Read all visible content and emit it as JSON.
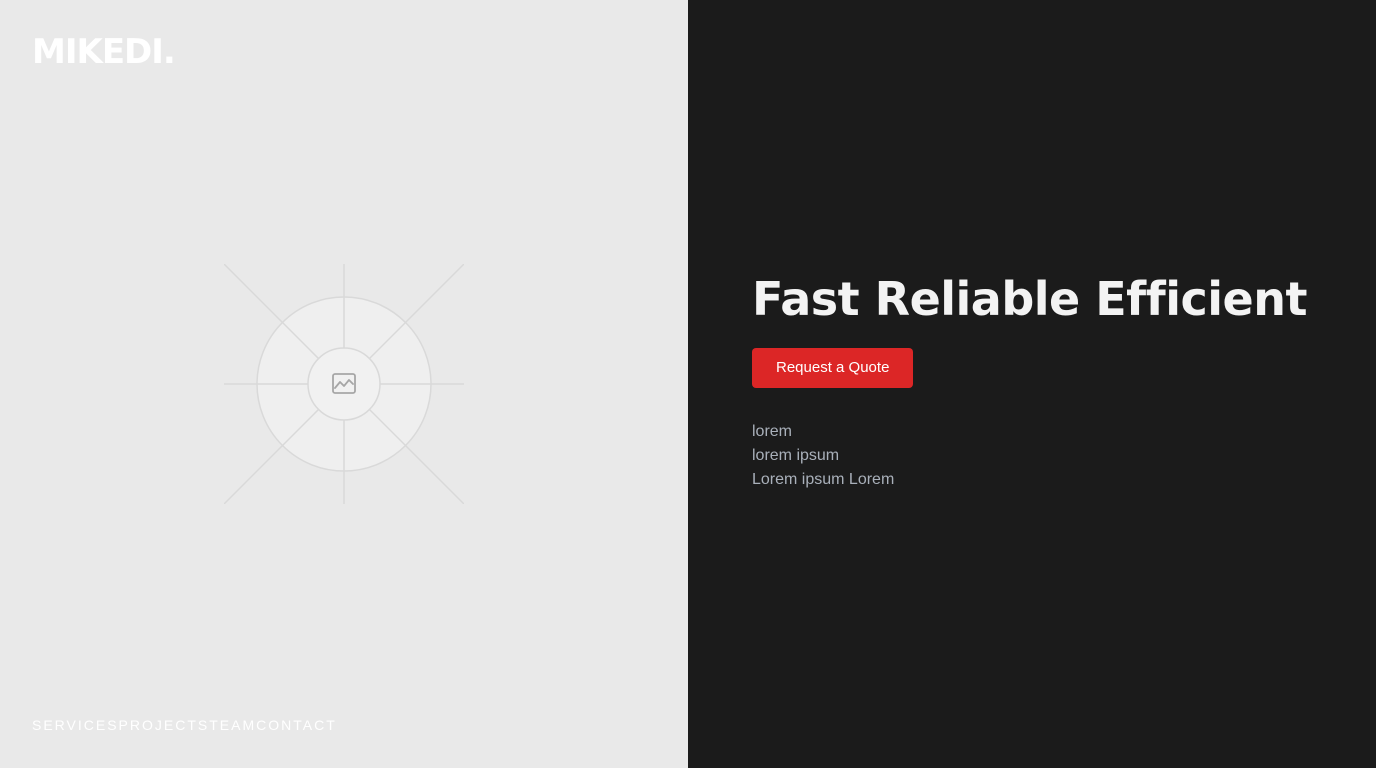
{
  "brand": {
    "logo_text": "MIKEDI."
  },
  "hero": {
    "image_placeholder_icon": "image-icon",
    "headline": "Fast Reliable Efficient",
    "cta_label": "Request a Quote",
    "features": [
      "lorem",
      "lorem ipsum",
      "Lorem ipsum Lorem"
    ]
  },
  "nav": {
    "items": [
      {
        "label": "SERVICES"
      },
      {
        "label": "PROJECTS"
      },
      {
        "label": "TEAM"
      },
      {
        "label": "CONTACT"
      }
    ]
  },
  "colors": {
    "left_panel_bg": "#e9e9e9",
    "right_panel_bg": "#1b1b1b",
    "accent": "#dc2626",
    "heading_text": "#f3f3f3",
    "muted_text": "#a9b0ba"
  }
}
